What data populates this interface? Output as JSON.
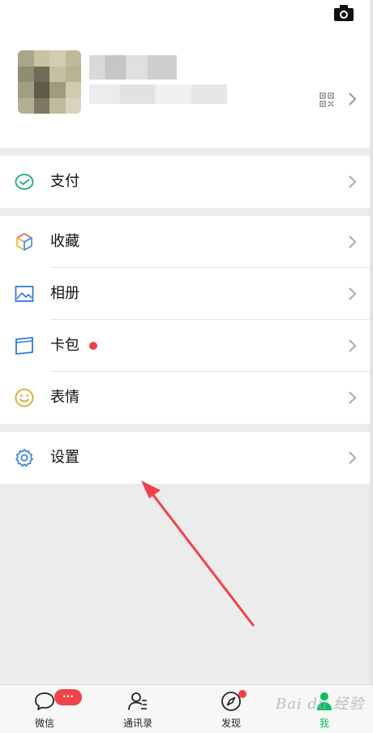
{
  "profile": {
    "name": "",
    "wechat_id": ""
  },
  "menu": {
    "pay": {
      "label": "支付",
      "icon": "wallet-icon"
    },
    "favorites": {
      "label": "收藏",
      "icon": "cube-icon"
    },
    "album": {
      "label": "相册",
      "icon": "picture-icon"
    },
    "cards": {
      "label": "卡包",
      "icon": "card-icon",
      "has_red_dot": true
    },
    "stickers": {
      "label": "表情",
      "icon": "smiley-icon"
    },
    "settings": {
      "label": "设置",
      "icon": "gear-icon"
    }
  },
  "tabbar": {
    "tabs": [
      {
        "label": "微信",
        "icon": "chat-bubble-icon",
        "badge": "···",
        "active": false
      },
      {
        "label": "通讯录",
        "icon": "contacts-icon",
        "active": false
      },
      {
        "label": "发现",
        "icon": "compass-icon",
        "has_red_dot": true,
        "active": false
      },
      {
        "label": "我",
        "icon": "person-icon",
        "active": true
      }
    ]
  },
  "watermark": "Bai du 经验",
  "colors": {
    "brand_green": "#07c160",
    "badge_red": "#f0424b",
    "annotation_arrow": "#f0424b"
  }
}
